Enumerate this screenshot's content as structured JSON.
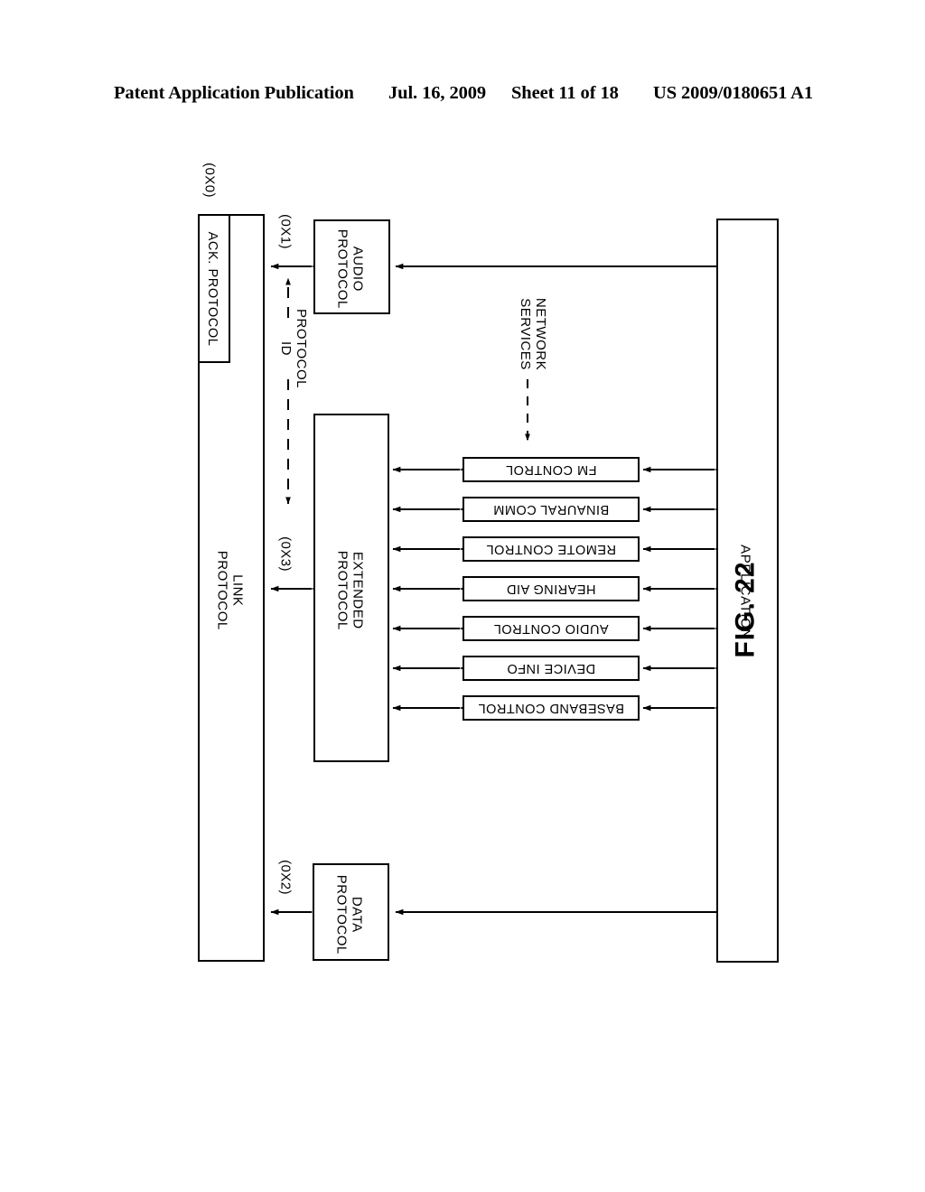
{
  "header": {
    "publication": "Patent Application Publication",
    "date": "Jul. 16, 2009",
    "sheet": "Sheet 11 of 18",
    "patent_number": "US 2009/0180651 A1"
  },
  "figure": {
    "caption": "FIG. 22",
    "application_block": "APPLICATION",
    "link_block": "LINK PROTOCOL",
    "link_block_line1": "LINK",
    "link_block_line2": "PROTOCOL",
    "ack_block": "ACK. PROTOCOL",
    "protocol_id_label_line1": "PROTOCOL",
    "protocol_id_label_line2": "ID",
    "network_services_line1": "NETWORK",
    "network_services_line2": "SERVICES",
    "protocols": [
      {
        "name": "DATA PROTOCOL",
        "line1": "DATA",
        "line2": "PROTOCOL",
        "id": "(0X2)"
      },
      {
        "name": "EXTENDED PROTOCOL",
        "line1": "EXTENDED",
        "line2": "PROTOCOL",
        "id": "(0X3)"
      },
      {
        "name": "AUDIO PROTOCOL",
        "line1": "AUDIO",
        "line2": "PROTOCOL",
        "id": "(0X1)"
      },
      {
        "name": "ACK. PROTOCOL",
        "id": "(0X0)"
      }
    ],
    "services": [
      "BASEBAND CONTROL",
      "DEVICE INFO",
      "AUDIO CONTROL",
      "HEARING AID",
      "REMOTE CONTROL",
      "BINAURAL COMM",
      "FM CONTROL"
    ]
  }
}
